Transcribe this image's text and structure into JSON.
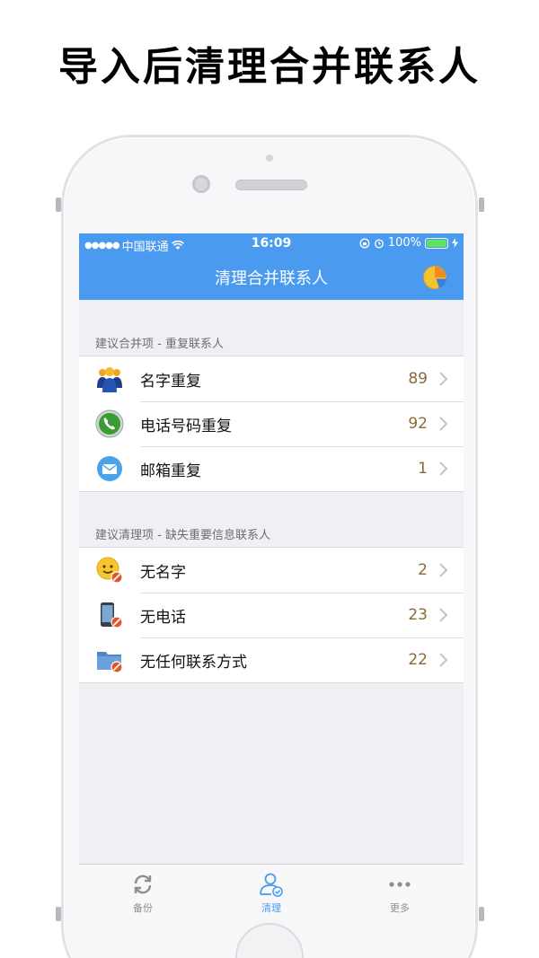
{
  "promo": {
    "title": "导入后清理合并联系人"
  },
  "status_bar": {
    "carrier": "中国联通",
    "time": "16:09",
    "battery": "100%"
  },
  "nav": {
    "title": "清理合并联系人",
    "chart_icon": "pie-chart-icon"
  },
  "sections": [
    {
      "header": "建议合并项 - 重复联系人",
      "rows": [
        {
          "label": "名字重复",
          "count": "89",
          "icon": "people-icon"
        },
        {
          "label": "电话号码重复",
          "count": "92",
          "icon": "phone-icon"
        },
        {
          "label": "邮箱重复",
          "count": "1",
          "icon": "mail-icon"
        }
      ]
    },
    {
      "header": "建议清理项 - 缺失重要信息联系人",
      "rows": [
        {
          "label": "无名字",
          "count": "2",
          "icon": "no-name-face-icon"
        },
        {
          "label": "无电话",
          "count": "23",
          "icon": "no-phone-icon"
        },
        {
          "label": "无任何联系方式",
          "count": "22",
          "icon": "no-contact-folder-icon"
        }
      ]
    }
  ],
  "tabs": [
    {
      "label": "备份",
      "icon": "refresh-icon",
      "active": false
    },
    {
      "label": "清理",
      "icon": "contact-check-icon",
      "active": true
    },
    {
      "label": "更多",
      "icon": "more-dots-icon",
      "active": false
    }
  ],
  "colors": {
    "accent": "#4a9af0",
    "count": "#8a6a36",
    "background": "#efeff4"
  }
}
